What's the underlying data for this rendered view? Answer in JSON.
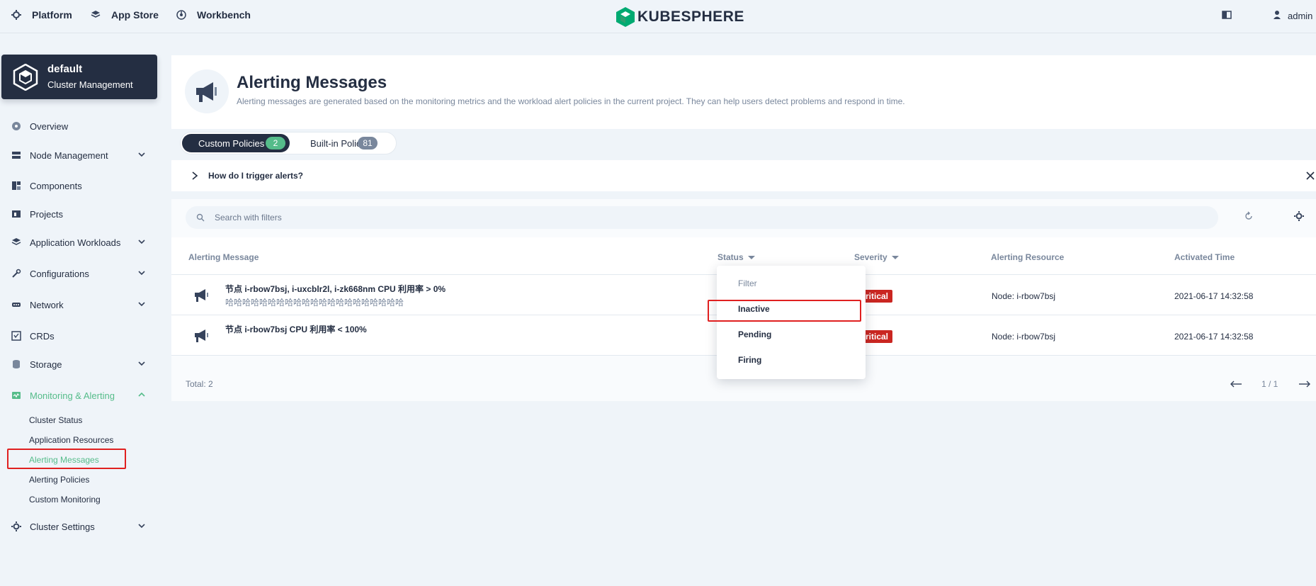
{
  "topnav": {
    "platform": "Platform",
    "app_store": "App Store",
    "workbench": "Workbench",
    "logo_text": "KUBESPHERE",
    "user": "admin"
  },
  "cluster": {
    "name": "default",
    "subtitle": "Cluster Management"
  },
  "sidebar": {
    "overview": "Overview",
    "node_management": "Node Management",
    "components": "Components",
    "projects": "Projects",
    "application_workloads": "Application Workloads",
    "configurations": "Configurations",
    "network": "Network",
    "crds": "CRDs",
    "storage": "Storage",
    "monitoring_alerting": "Monitoring & Alerting",
    "monitoring_children": {
      "cluster_status": "Cluster Status",
      "application_resources": "Application Resources",
      "alerting_messages": "Alerting Messages",
      "alerting_policies": "Alerting Policies",
      "custom_monitoring": "Custom Monitoring"
    },
    "cluster_settings": "Cluster Settings"
  },
  "page": {
    "title": "Alerting Messages",
    "description": "Alerting messages are generated based on the monitoring metrics and the workload alert policies in the current project. They can help users detect problems and respond in time."
  },
  "tabs": {
    "custom": {
      "label": "Custom Policies",
      "count": "2"
    },
    "builtin": {
      "label": "Built-in Policies",
      "count": "81"
    }
  },
  "tip": {
    "text": "How do I trigger alerts?"
  },
  "search": {
    "placeholder": "Search with filters"
  },
  "table": {
    "headers": {
      "message": "Alerting Message",
      "status": "Status",
      "severity": "Severity",
      "resource": "Alerting Resource",
      "time": "Activated Time"
    },
    "rows": [
      {
        "title": "节点 i-rbow7bsj, i-uxcblr2l, i-zk668nm CPU 利用率 > 0%",
        "subtitle": "哈哈哈哈哈哈哈哈哈哈哈哈哈哈哈哈哈哈哈哈哈",
        "severity": "ritical",
        "resource": "Node: i-rbow7bsj",
        "time": "2021-06-17 14:32:58"
      },
      {
        "title": "节点 i-rbow7bsj CPU 利用率 < 100%",
        "subtitle": "",
        "severity": "ritical",
        "resource": "Node: i-rbow7bsj",
        "time": "2021-06-17 14:32:58"
      }
    ],
    "total": "Total: 2",
    "page": "1 / 1"
  },
  "status_dropdown": {
    "options": [
      "Filter",
      "Inactive",
      "Pending",
      "Firing"
    ]
  },
  "colors": {
    "accent": "#55bc8a",
    "dark": "#242e42",
    "critical": "#ca2621",
    "highlight": "#e02020"
  }
}
